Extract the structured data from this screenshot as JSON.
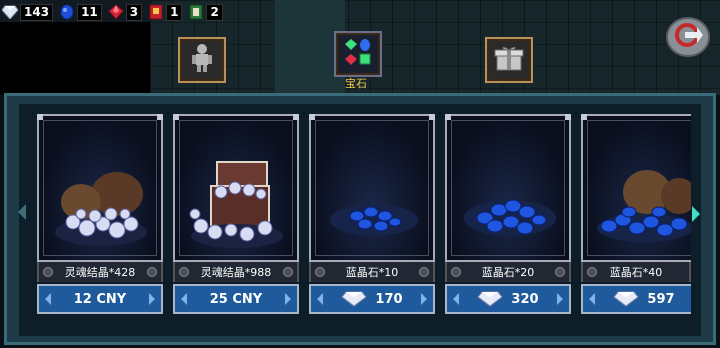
{
  "resources": [
    {
      "name": "white-diamond-icon",
      "value": "143"
    },
    {
      "name": "blue-sapphire-icon",
      "value": "11"
    },
    {
      "name": "red-ruby-icon",
      "value": "3"
    },
    {
      "name": "red-ticket-icon",
      "value": "1"
    },
    {
      "name": "green-card-icon",
      "value": "2"
    }
  ],
  "tabs": {
    "active_label": "宝石"
  },
  "cards": [
    {
      "label": "灵魂结晶*428",
      "price": "12 CNY",
      "price_type": "cny",
      "art": "soul-crystal-bag-icon"
    },
    {
      "label": "灵魂结晶*988",
      "price": "25 CNY",
      "price_type": "cny",
      "art": "soul-crystal-chest-icon"
    },
    {
      "label": "蓝晶石*10",
      "price": "170",
      "price_type": "diamond",
      "art": "sapphire-pile-small-icon"
    },
    {
      "label": "蓝晶石*20",
      "price": "320",
      "price_type": "diamond",
      "art": "sapphire-pile-medium-icon"
    },
    {
      "label": "蓝晶石*40",
      "price": "597",
      "price_type": "diamond",
      "art": "sapphire-bag-icon"
    }
  ],
  "colors": {
    "price_button": "#1f5a9c",
    "panel": "#1c3a48",
    "tab_label": "#f2c94c"
  }
}
